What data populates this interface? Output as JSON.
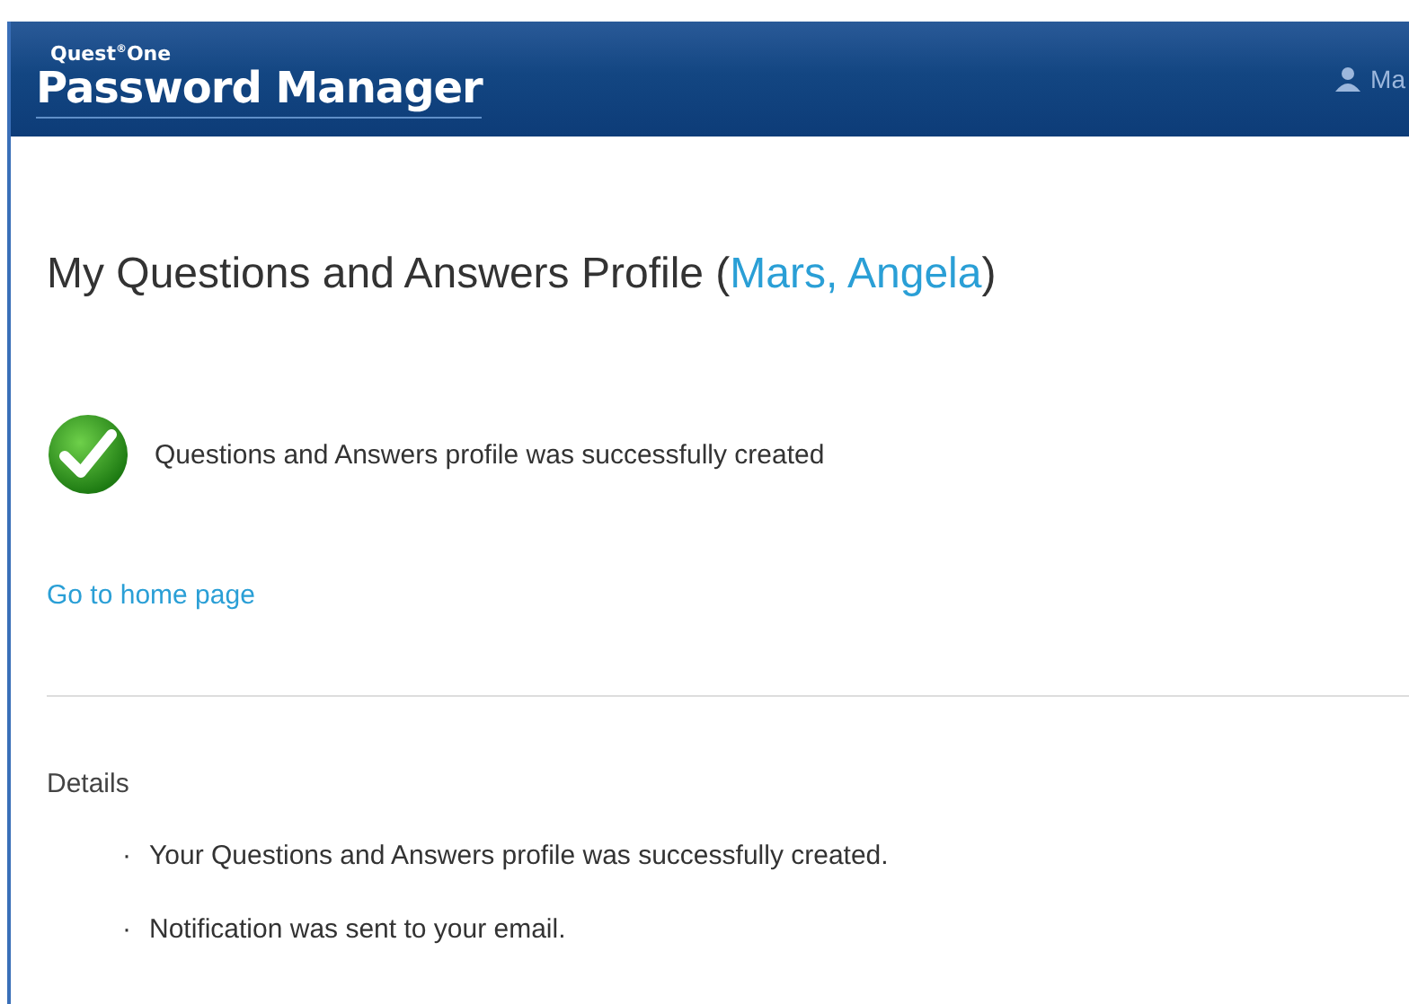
{
  "header": {
    "brand_small": "Quest",
    "brand_mark": "®",
    "brand_small_2": "One",
    "brand_title": "Password Manager",
    "user": "Ma"
  },
  "page": {
    "title": "My Questions and Answers Profile (",
    "user_link": "Mars, Angela",
    "title_end": ")"
  },
  "message": {
    "kind": "success",
    "text": "Questions and Answers profile was successfully created"
  },
  "home_link": "Go to home page",
  "details": {
    "heading": "Details",
    "items": [
      {
        "marker": "·",
        "text": "Your Questions and Answers profile was successfully created."
      },
      {
        "marker": "·",
        "text": "Notification was sent to your email."
      }
    ]
  }
}
